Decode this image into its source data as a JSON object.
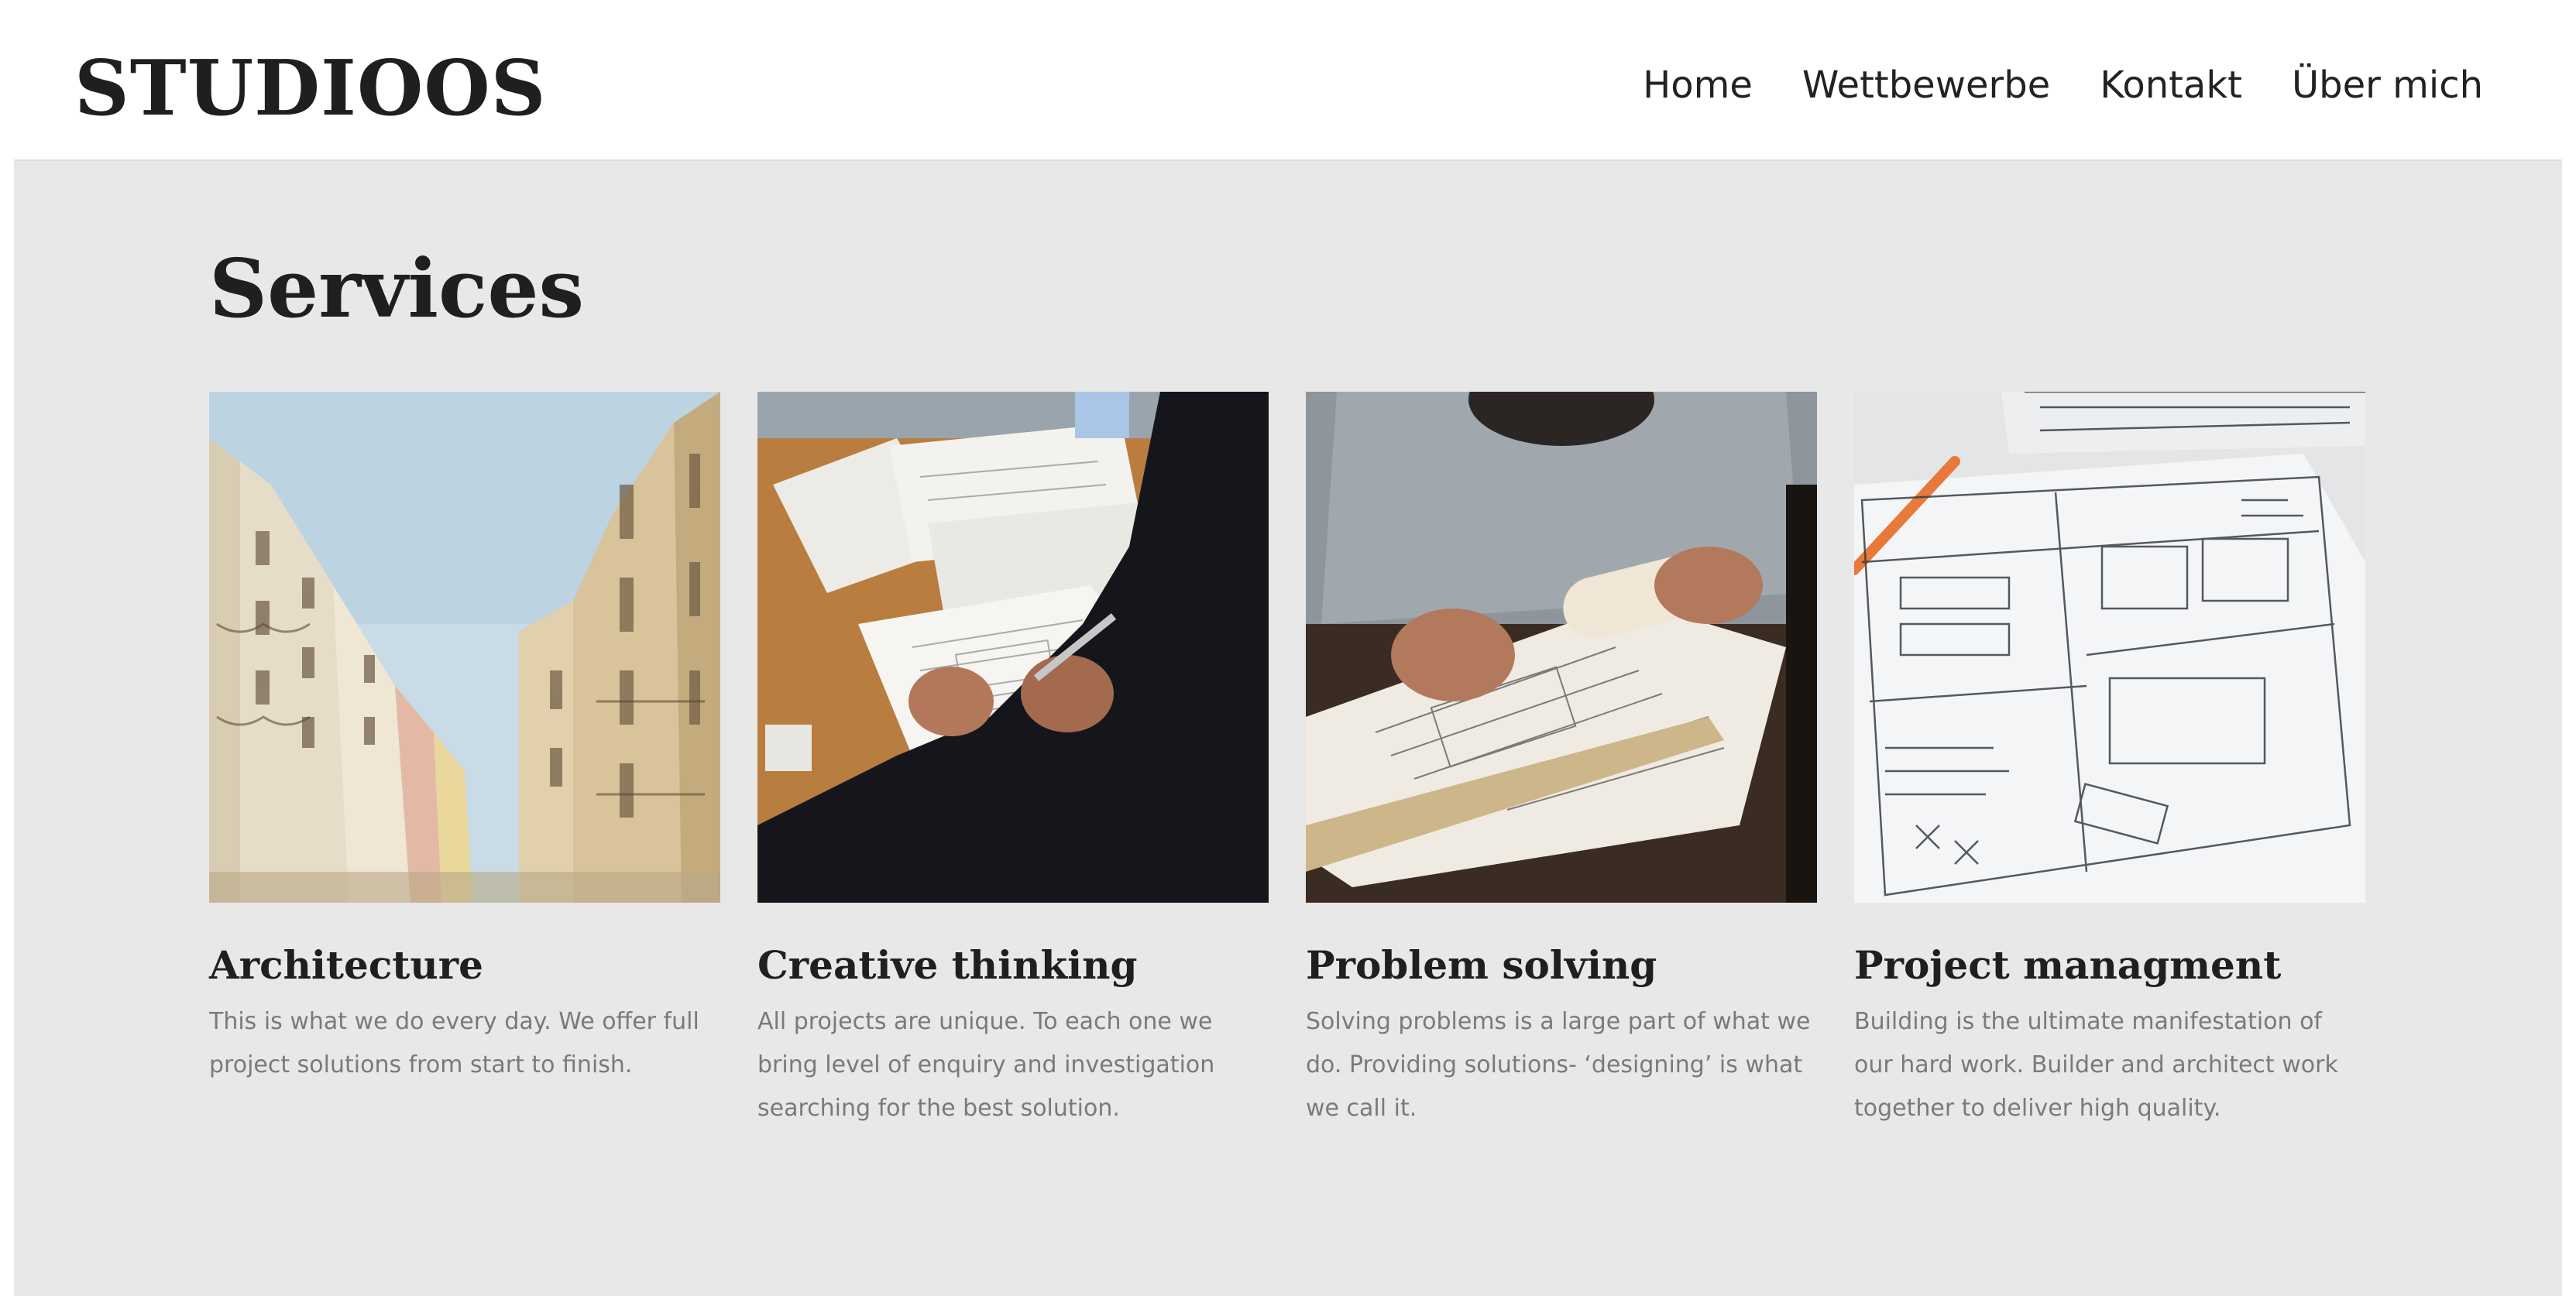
{
  "site": {
    "logo": "STUDIOOS"
  },
  "nav": {
    "items": [
      {
        "label": "Home"
      },
      {
        "label": "Wettbewerbe"
      },
      {
        "label": "Kontakt"
      },
      {
        "label": "Über mich"
      }
    ]
  },
  "services": {
    "title": "Services",
    "cards": [
      {
        "title": "Architecture",
        "text": "This is what we do every day. We offer full project solutions from start to finish.",
        "image": "building-facade-photo"
      },
      {
        "title": "Creative thinking",
        "text": "All projects are unique. To each one we bring level of enquiry and investigation searching for the best solution.",
        "image": "hands-sketching-photo"
      },
      {
        "title": "Problem solving",
        "text": "Solving problems is a large part of what we do. Providing solutions- ‘designing’ is what we call it.",
        "image": "architect-drawing-plans-photo"
      },
      {
        "title": "Project managment",
        "text": "Building is the ultimate manifestation of our hard work. Builder and architect work together to deliver high quality.",
        "image": "wireframe-sketch-photo"
      }
    ]
  }
}
